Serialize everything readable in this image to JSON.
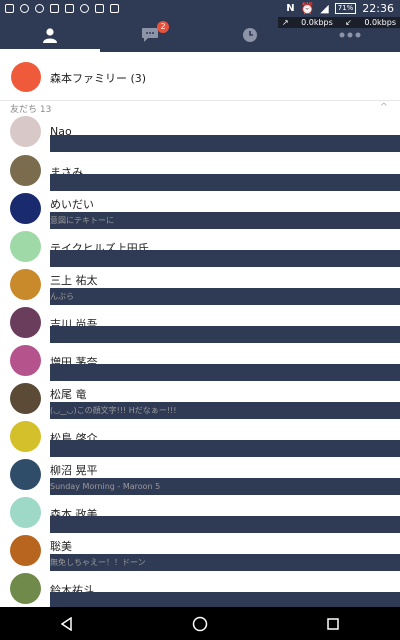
{
  "status_bar": {
    "time": "22:36",
    "battery": "71%",
    "net_up": "0.0kbps",
    "net_down": "0.0kbps",
    "nfc": "N"
  },
  "header": {
    "background_color": "#2f3a55",
    "tabs": [
      {
        "icon": "person-icon",
        "active": true
      },
      {
        "icon": "chat-bubble-icon",
        "badge": "2",
        "active": false
      },
      {
        "icon": "clock-icon",
        "active": false
      },
      {
        "icon": "more-dots-icon",
        "active": false
      }
    ]
  },
  "group": {
    "name": "森本ファミリー (3)",
    "avatar_color": "#ef5b3a"
  },
  "section": {
    "label": "友だち 13",
    "caret": "^"
  },
  "friends": [
    {
      "name": "Nao",
      "status": "",
      "avatar_color": "#d9c8c8"
    },
    {
      "name": "まさみ",
      "status": "",
      "avatar_color": "#7b6c4e"
    },
    {
      "name": "めいだい",
      "status": "意図にテキトーに",
      "avatar_color": "#1a2a6e"
    },
    {
      "name": "テイクヒルズ上田氏",
      "status": "",
      "avatar_color": "#9fd9a7"
    },
    {
      "name": "三上 祐太",
      "status": "んぶら",
      "avatar_color": "#c88a2a"
    },
    {
      "name": "吉川 尚吾",
      "status": "",
      "avatar_color": "#6b3d5c"
    },
    {
      "name": "増田 茅奈",
      "status": "",
      "avatar_color": "#b5538d"
    },
    {
      "name": "松尾 竜",
      "status": "(◡‿◡)この顔文字!!! Hだなぁー!!!",
      "avatar_color": "#5a4a36"
    },
    {
      "name": "松島 啓介",
      "status": "",
      "avatar_color": "#d4c02a"
    },
    {
      "name": "柳沼 晃平",
      "status": "Sunday Morning - Maroon 5",
      "avatar_color": "#2f4d68"
    },
    {
      "name": "森本 政美",
      "status": "",
      "avatar_color": "#9ed8c7"
    },
    {
      "name": "聡美",
      "status": "無免しちゃえー！！ドーン",
      "avatar_color": "#b8651f"
    },
    {
      "name": "鈴木祐斗",
      "status": "",
      "avatar_color": "#6f8a4a"
    }
  ],
  "navbar": {
    "buttons": [
      {
        "icon": "back-triangle-icon"
      },
      {
        "icon": "home-circle-icon"
      },
      {
        "icon": "recents-square-icon"
      }
    ]
  }
}
